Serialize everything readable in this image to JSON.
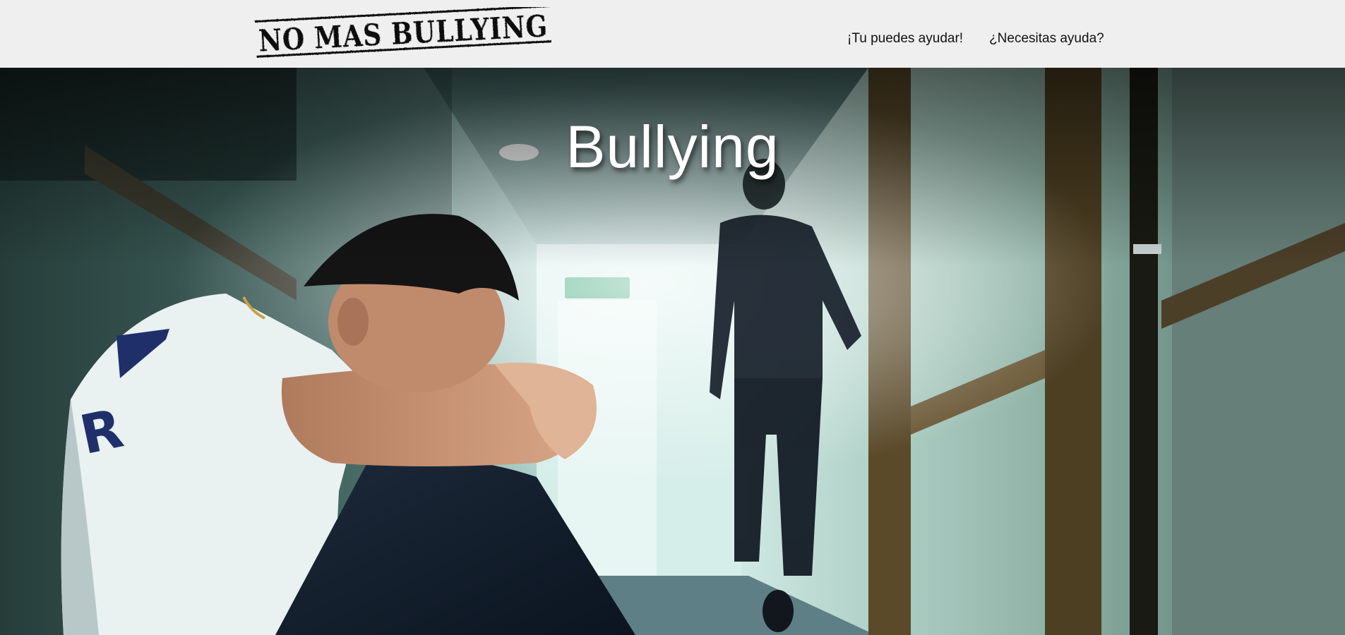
{
  "header": {
    "logo_text": "NO MAS BULLYING",
    "nav": [
      {
        "label": "¡Tu puedes ayudar!"
      },
      {
        "label": "¿Necesitas ayuda?"
      }
    ]
  },
  "hero": {
    "title": "Bullying",
    "shirt_letters": "R"
  },
  "colors": {
    "header_bg": "#efefef",
    "title_text": "#ffffff",
    "hallway_tone": "#9fc7bf"
  }
}
